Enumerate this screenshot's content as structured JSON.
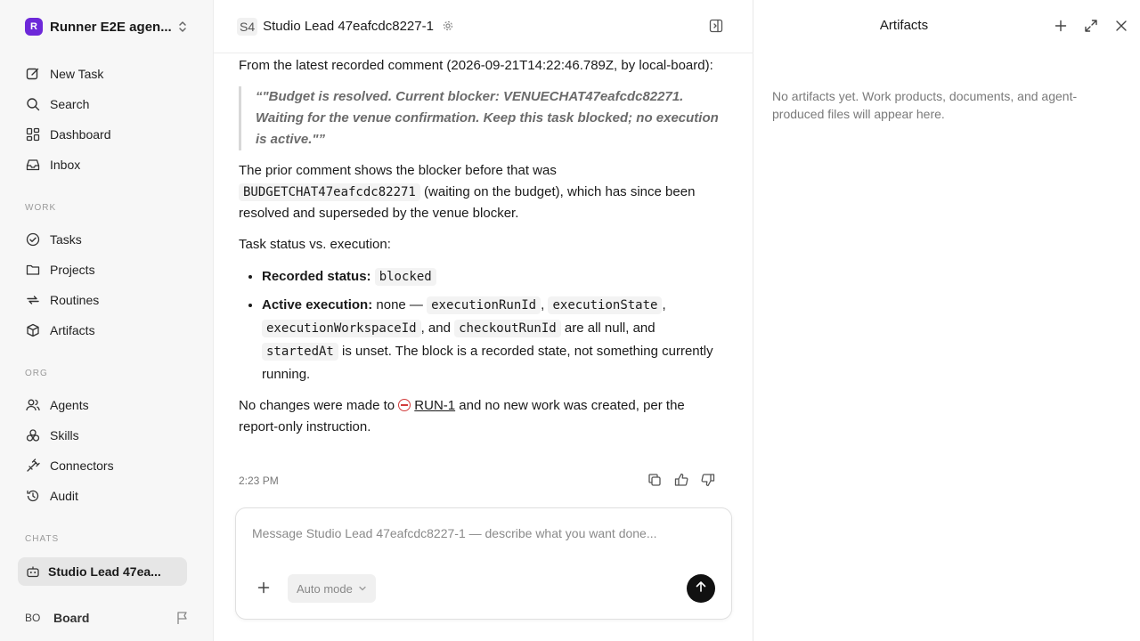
{
  "workspace": {
    "logo": "R",
    "name": "Runner E2E agen...",
    "accent": "#6d28d9"
  },
  "nav": {
    "main": [
      {
        "label": "New Task",
        "icon": "edit-icon"
      },
      {
        "label": "Search",
        "icon": "search-icon"
      },
      {
        "label": "Dashboard",
        "icon": "dashboard-icon"
      },
      {
        "label": "Inbox",
        "icon": "inbox-icon"
      }
    ],
    "work_label": "WORK",
    "work": [
      {
        "label": "Tasks",
        "icon": "check-circle-icon"
      },
      {
        "label": "Projects",
        "icon": "folder-icon"
      },
      {
        "label": "Routines",
        "icon": "repeat-icon"
      },
      {
        "label": "Artifacts",
        "icon": "box-icon"
      }
    ],
    "org_label": "ORG",
    "org": [
      {
        "label": "Agents",
        "icon": "users-icon"
      },
      {
        "label": "Skills",
        "icon": "skills-icon"
      },
      {
        "label": "Connectors",
        "icon": "plug-icon"
      },
      {
        "label": "Audit",
        "icon": "history-icon"
      }
    ],
    "chats_label": "CHATS",
    "chats": [
      {
        "label": "Studio Lead 47ea...",
        "icon": "bot-icon"
      }
    ]
  },
  "user": {
    "initials": "BO",
    "name": "Board"
  },
  "header": {
    "avatar": "S4",
    "title": "Studio Lead 47eafcdc8227-1"
  },
  "message": {
    "p1": "From the latest recorded comment (2026-09-21T14:22:46.789Z, by local-board):",
    "quote": "“\"Budget is resolved. Current blocker: VENUECHAT47eafcdc82271. Waiting for the venue confirmation. Keep this task blocked; no execution is active.\"”",
    "p2_a": "The prior comment shows the blocker before that was",
    "p2_code": "BUDGETCHAT47eafcdc82271",
    "p2_b": "(waiting on the budget), which has since been resolved and superseded by the venue blocker.",
    "p3": "Task status vs. execution:",
    "b1_label": "Recorded status:",
    "b1_code": "blocked",
    "b2_label": "Active execution:",
    "b2_a": "none —",
    "b2_code1": "executionRunId",
    "b2_code2": "executionState",
    "b2_code3": "executionWorkspaceId",
    "b2_and": ", and",
    "b2_code4": "checkoutRunId",
    "b2_b": "are all null, and",
    "b2_code5": "startedAt",
    "b2_c": "is unset. The block is a recorded state, not something currently running.",
    "p4_a": "No changes were made to",
    "p4_link": "RUN-1",
    "p4_b": "and no new work was created, per the report-only instruction.",
    "time": "2:23 PM"
  },
  "composer": {
    "placeholder": "Message Studio Lead 47eafcdc8227-1 — describe what you want done...",
    "mode": "Auto mode"
  },
  "artifacts": {
    "title": "Artifacts",
    "empty": "No artifacts yet. Work products, documents, and agent-produced files will appear here."
  },
  "colors": {
    "blocked": "#d13b3b",
    "sidebar_bg": "#f7f7f7"
  }
}
